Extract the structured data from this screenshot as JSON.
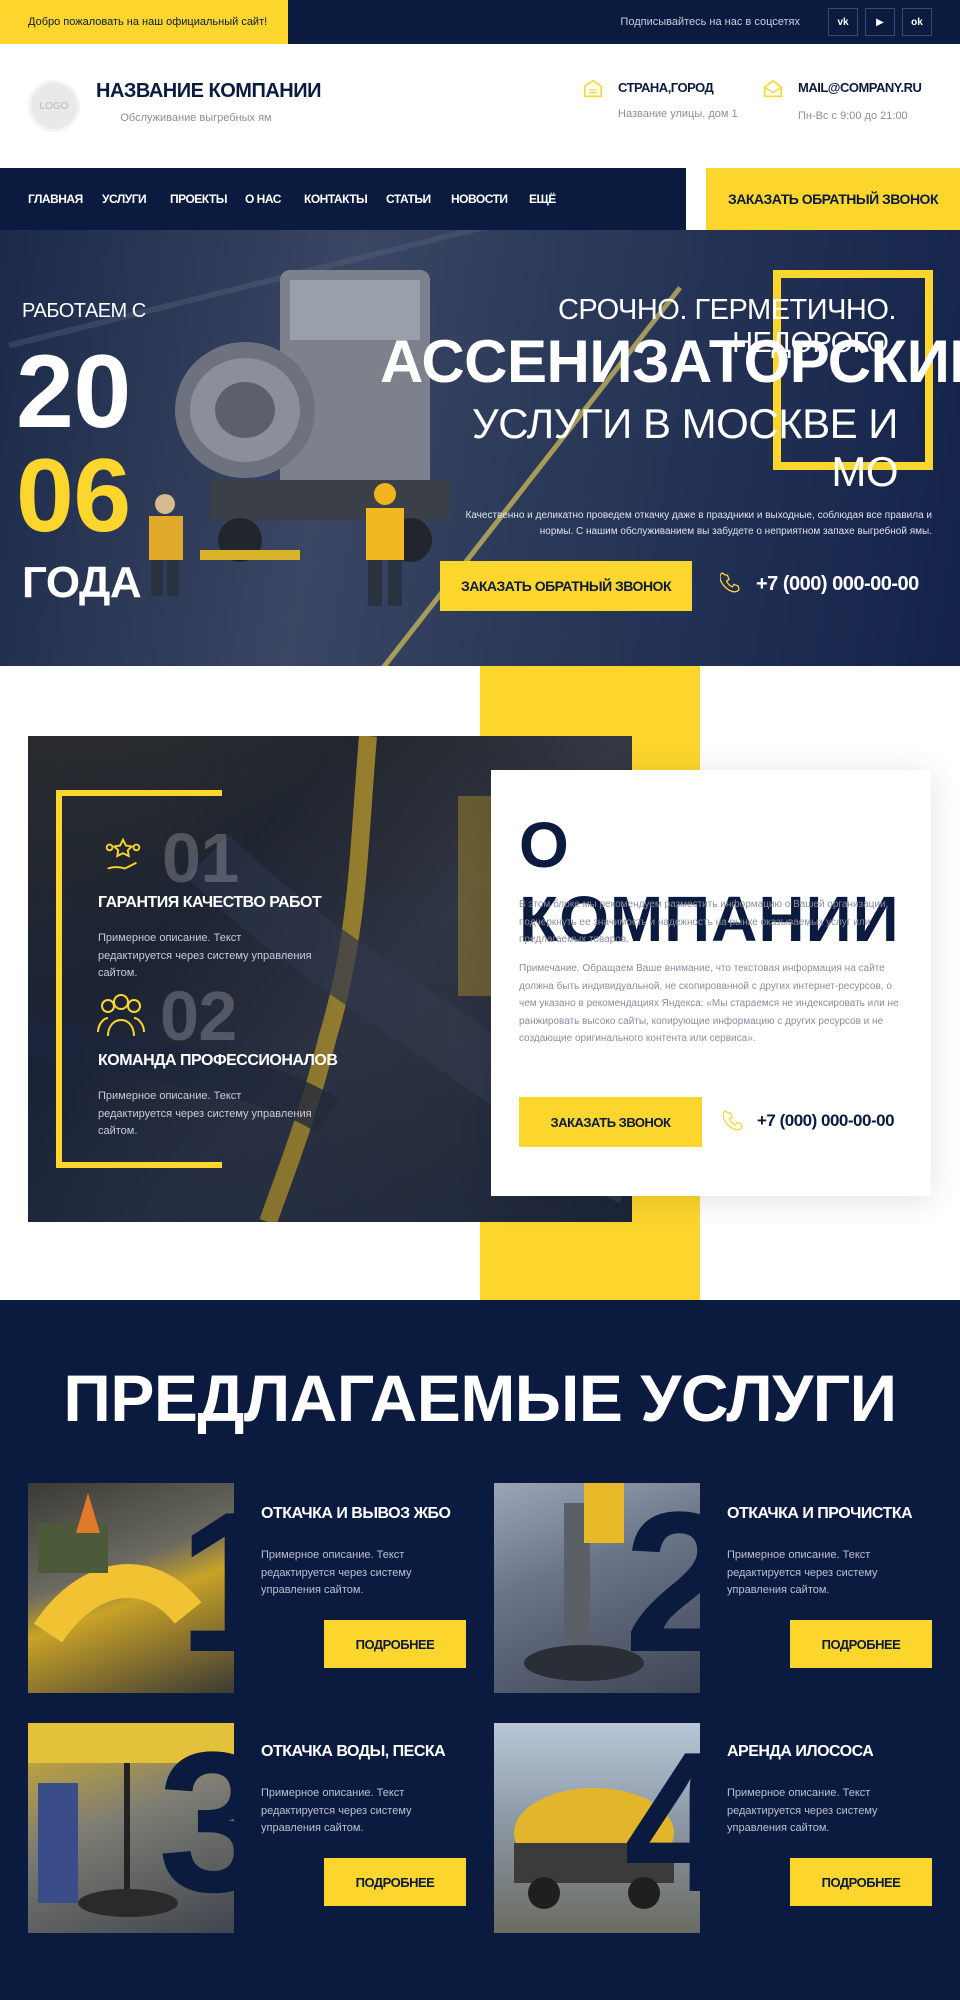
{
  "topbar": {
    "welcome": "Добро пожаловать на наш официальный сайт!",
    "subscribe": "Подписывайтесь на нас в соцсетях",
    "socials": [
      {
        "icon": "vk-icon",
        "glyph": "vk"
      },
      {
        "icon": "youtube-icon",
        "glyph": "▶"
      },
      {
        "icon": "odnoklassniki-icon",
        "glyph": "ok"
      }
    ]
  },
  "header": {
    "logo": "LOGO",
    "company_name": "НАЗВАНИЕ КОМПАНИИ",
    "company_sub": "Обслуживание выгребных ям",
    "address_title": "СТРАНА,ГОРОД",
    "address_sub": "Название улицы, дом 1",
    "mail_title": "MAIL@COMPANY.RU",
    "mail_sub": "Пн-Вс с 9:00 до 21:00"
  },
  "nav": {
    "items": [
      "ГЛАВНАЯ",
      "УСЛУГИ",
      "ПРОЕКТЫ",
      "О НАС",
      "КОНТАКТЫ",
      "СТАТЬИ",
      "НОВОСТИ",
      "ЕЩЁ"
    ],
    "cta": "ЗАКАЗАТЬ ОБРАТНЫЙ ЗВОНОК"
  },
  "hero": {
    "since_label": "РАБОТАЕМ С",
    "year_part1": "20",
    "year_part2": "06",
    "year_suffix": "ГОДА",
    "tagline": "СРОЧНО. ГЕРМЕТИЧНО. НЕДОРОГО.",
    "title": "АССЕНИЗАТОРСКИЕ",
    "subtitle": "УСЛУГИ В МОСКВЕ И МО",
    "description": "Качественно и деликатно проведем откачку даже в праздники и выходные, соблюдая все правила и нормы. С нашим обслуживанием вы забудете о неприятном запахе выгребной ямы.",
    "button": "ЗАКАЗАТЬ ОБРАТНЫЙ ЗВОНОК",
    "phone": "+7 (000) 000-00-00"
  },
  "about": {
    "features": [
      {
        "num": "01",
        "title": "ГАРАНТИЯ КАЧЕСТВО РАБОТ",
        "text": "Примерное описание. Текст редактируется через систему управления сайтом."
      },
      {
        "num": "02",
        "title": "КОМАНДА ПРОФЕССИОНАЛОВ",
        "text": "Примерное описание. Текст редактируется через систему управления сайтом."
      }
    ],
    "title": "О КОМПАНИИ",
    "paragraph1": "В этом блоке мы рекомендуем разместить информацию о Вашей организации, подчеркнуть ее значимость и надежность на рынке оказываемых услуг или предлагаемых товаров.",
    "paragraph2": "Примечание. Обращаем Ваше внимание, что текстовая информация на сайте должна быть индивидуальной, не скопированной с других интернет-ресурсов, о чем указано в рекомендациях Яндекса: «Мы стараемся не индексировать или не ранжировать высоко сайты, копирующие информацию с других ресурсов и не создающие оригинального контента или сервиса».",
    "button": "ЗАКАЗАТЬ ЗВОНОК",
    "phone": "+7 (000) 000-00-00"
  },
  "services": {
    "title": "ПРЕДЛАГАЕМЫЕ УСЛУГИ",
    "items": [
      {
        "num": "1",
        "title": "ОТКАЧКА И ВЫВОЗ ЖБО",
        "text": "Примерное описание. Текст редактируется через систему управления сайтом.",
        "button": "ПОДРОБНЕЕ"
      },
      {
        "num": "2",
        "title": "ОТКАЧКА И ПРОЧИСТКА",
        "text": "Примерное описание. Текст редактируется через систему управления сайтом.",
        "button": "ПОДРОБНЕЕ"
      },
      {
        "num": "3",
        "title": "ОТКАЧКА ВОДЫ, ПЕСКА",
        "text": "Примерное описание. Текст редактируется через систему управления сайтом.",
        "button": "ПОДРОБНЕЕ"
      },
      {
        "num": "4",
        "title": "АРЕНДА ИЛОСОСА",
        "text": "Примерное описание. Текст редактируется через систему управления сайтом.",
        "button": "ПОДРОБНЕЕ"
      }
    ]
  },
  "colors": {
    "navy": "#0b1b3f",
    "accent": "#fcd62d"
  }
}
